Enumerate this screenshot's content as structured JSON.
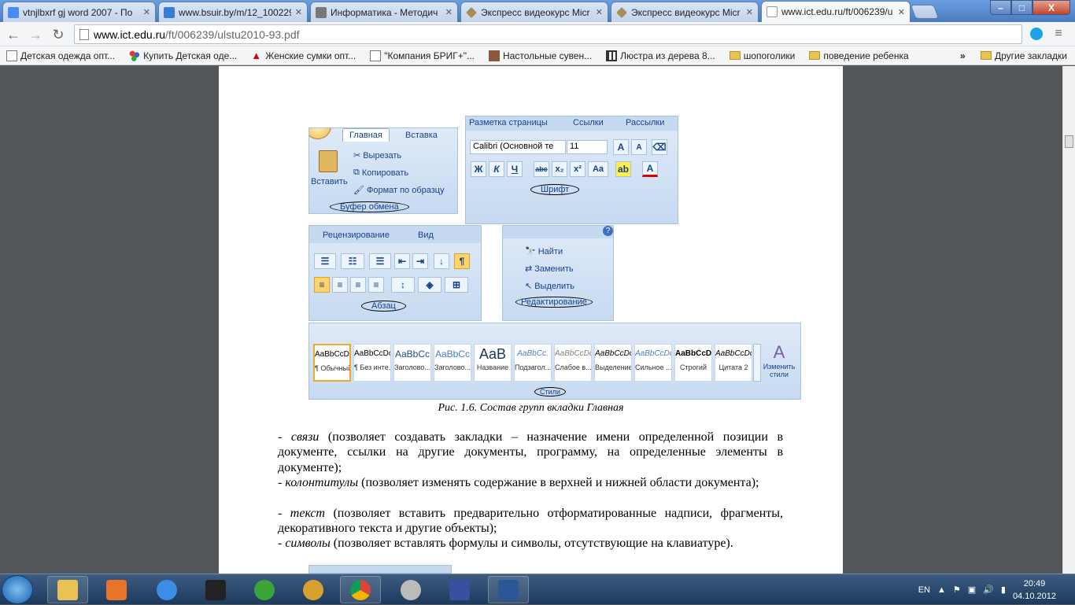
{
  "tabs": [
    {
      "title": "vtnjlbxrf gj word 2007 - По",
      "favicon": "google-icon",
      "color": "#4a8af4"
    },
    {
      "title": "www.bsuir.by/m/12_100229",
      "favicon": "page-icon",
      "color": "#3a7bd5"
    },
    {
      "title": "Информатика - Методич",
      "favicon": "printer-icon",
      "color": "#666666"
    },
    {
      "title": "Экспресс видеокурс Micr",
      "favicon": "diamond-icon",
      "color": "#a58c5a"
    },
    {
      "title": "Экспресс видеокурс Micr",
      "favicon": "diamond-icon",
      "color": "#a58c5a"
    },
    {
      "title": "www.ict.edu.ru/ft/006239/u",
      "favicon": "doc-icon",
      "color": "#ffffff"
    }
  ],
  "window_controls": {
    "minimize": "–",
    "maximize": "□",
    "close": "X"
  },
  "address": {
    "host": "www.ict.edu.ru",
    "path": "/ft/006239/ulstu2010-93.pdf"
  },
  "bookmarks": [
    {
      "label": "Детская одежда опт...",
      "icon": "page-icon"
    },
    {
      "label": "Купить Детская оде...",
      "icon": "dots-icon"
    },
    {
      "label": "Женские сумки опт...",
      "icon": "warning-icon"
    },
    {
      "label": "\"Компания БРИГ+\"...",
      "icon": "page-icon"
    },
    {
      "label": "Настольные сувен...",
      "icon": "image-icon"
    },
    {
      "label": "Люстра из дерева 8...",
      "icon": "grid-icon"
    },
    {
      "label": "шопоголики",
      "icon": "folder-icon"
    },
    {
      "label": "поведение ребенка",
      "icon": "folder-icon"
    }
  ],
  "bookmarks_overflow": "»",
  "other_bookmarks": "Другие закладки",
  "ribbon": {
    "tab_home": "Главная",
    "tab_insert": "Вставка",
    "paste": "Вставить",
    "cut": "Вырезать",
    "copy": "Копировать",
    "format_painter": "Формат по образцу",
    "clipboard_group": "Буфер обмена",
    "tab_layout": "Разметка страницы",
    "tab_refs": "Ссылки",
    "tab_mail": "Рассылки",
    "font_name": "Calibri (Основной те",
    "font_size": "11",
    "font_group": "Шрифт",
    "fmt_buttons": [
      "Ж",
      "К",
      "Ч",
      "abc",
      "x₂",
      "x²",
      "Aa"
    ],
    "tab_review": "Рецензирование",
    "tab_view": "Вид",
    "para_group": "Абзац",
    "find": "Найти",
    "replace": "Заменить",
    "select": "Выделить",
    "edit_group": "Редактирование",
    "styles": [
      {
        "sample": "AaBbCcDc",
        "name": "¶ Обычный"
      },
      {
        "sample": "AaBbCcDc",
        "name": "¶ Без инте..."
      },
      {
        "sample": "AaBbCc",
        "name": "Заголово..."
      },
      {
        "sample": "AaBbCc",
        "name": "Заголово..."
      },
      {
        "sample": "AaB",
        "name": "Название"
      },
      {
        "sample": "AaBbCc.",
        "name": "Подзагол..."
      },
      {
        "sample": "AaBbCcDc",
        "name": "Слабое в..."
      },
      {
        "sample": "AaBbCcDc",
        "name": "Выделение"
      },
      {
        "sample": "AaBbCcDc",
        "name": "Сильное ..."
      },
      {
        "sample": "AaBbCcDc",
        "name": "Строгий"
      },
      {
        "sample": "AaBbCcDc",
        "name": "Цитата 2"
      }
    ],
    "change_styles": "Изменить стили",
    "styles_group": "Стили"
  },
  "caption": "Рис. 1.6. Состав групп вкладки Главная",
  "paragraphs": [
    {
      "term": "связи",
      "text": " (позволяет создавать закладки – назначение имени определенной позиции в документе, ссылки на другие документы, программу, на определенные элементы в документе);"
    },
    {
      "term": "колонтитулы",
      "text": " (позволяет изменять  содержание в верхней и нижней области документа);"
    },
    {
      "term": "текст",
      "text": " (позволяет вставить предварительно отформатированные надписи, фрагменты, декоративного текста и другие объекты);"
    },
    {
      "term": "символы",
      "text": " (позволяет вставлять формулы и символы, отсутствующие на клавиатуре)."
    }
  ],
  "tray": {
    "lang": "EN",
    "time": "20:49",
    "date": "04.10.2012"
  }
}
